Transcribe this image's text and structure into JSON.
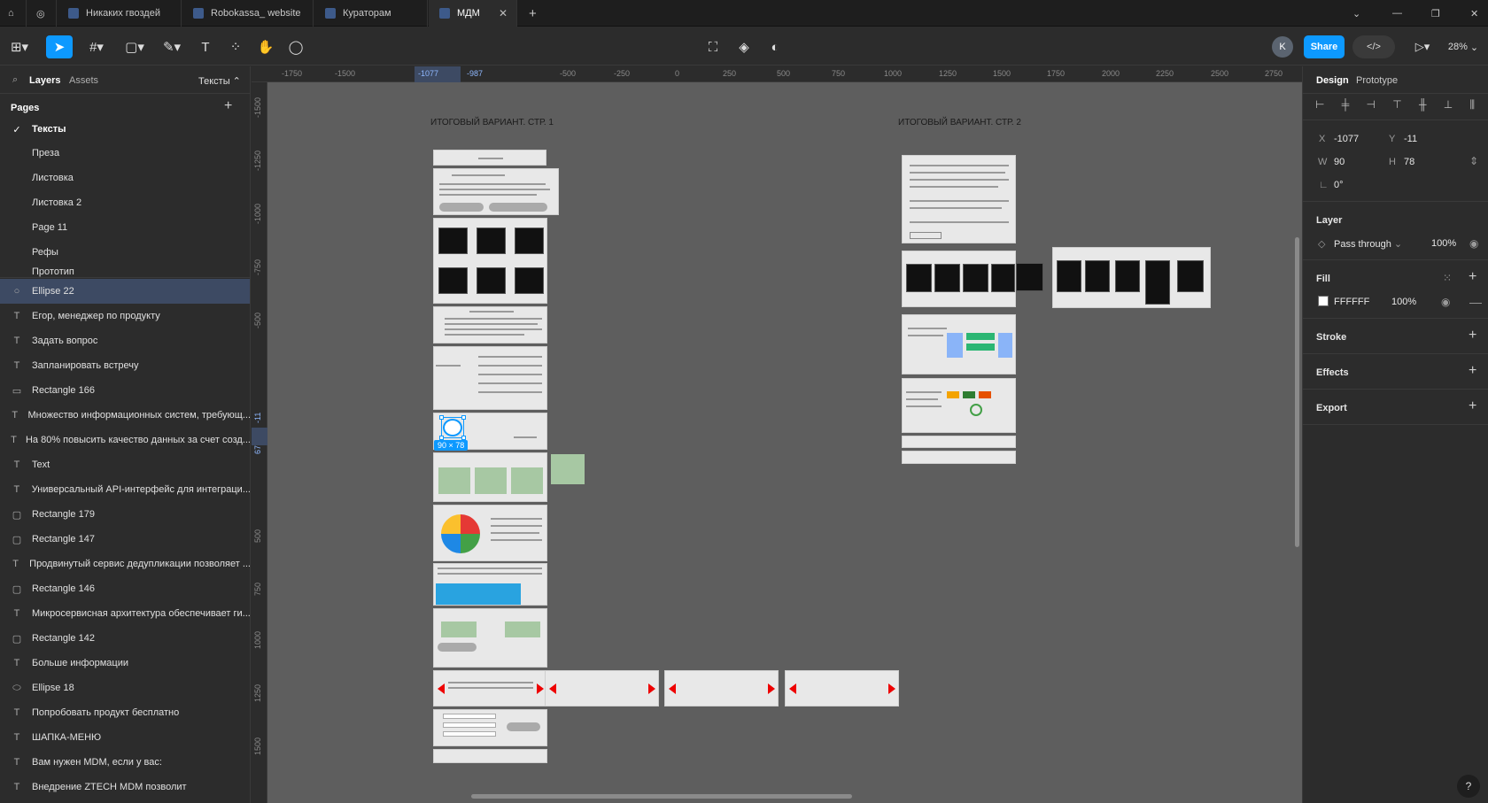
{
  "tabs": [
    {
      "label": "Никаких гвоздей"
    },
    {
      "label": "Robokassa_ website"
    },
    {
      "label": "Кураторам"
    },
    {
      "label": "МДМ"
    }
  ],
  "toolbar": {
    "share_label": "Share",
    "zoom": "28%",
    "avatar": "K"
  },
  "left": {
    "layers_tab": "Layers",
    "assets_tab": "Assets",
    "page_selector": "Тексты",
    "pages_title": "Pages",
    "pages": [
      "Тексты",
      "Преза",
      "Листовка",
      "Листовка 2",
      "Page 11",
      "Рефы",
      "Прототип"
    ],
    "layers": [
      {
        "icon": "ellipse-icon",
        "label": "Ellipse 22"
      },
      {
        "icon": "text-icon",
        "label": "Егор, менеджер по продукту"
      },
      {
        "icon": "text-icon",
        "label": "Задать вопрос"
      },
      {
        "icon": "text-icon",
        "label": "Запланировать встречу"
      },
      {
        "icon": "rectangle-icon",
        "label": "Rectangle 166"
      },
      {
        "icon": "text-icon",
        "label": "Множество информационных систем, требующ..."
      },
      {
        "icon": "text-icon",
        "label": "На 80% повысить качество данных за счет созд..."
      },
      {
        "icon": "text-icon",
        "label": "Text"
      },
      {
        "icon": "text-icon",
        "label": "Универсальный API-интерфейс для интеграци..."
      },
      {
        "icon": "rectangle-icon",
        "label": "Rectangle 179"
      },
      {
        "icon": "rectangle-icon",
        "label": "Rectangle 147"
      },
      {
        "icon": "text-icon",
        "label": "Продвинутый сервис дедупликации позволяет ..."
      },
      {
        "icon": "rectangle-icon",
        "label": "Rectangle 146"
      },
      {
        "icon": "text-icon",
        "label": "Микросервисная архитектура обеспечивает ги..."
      },
      {
        "icon": "rectangle-icon",
        "label": "Rectangle 142"
      },
      {
        "icon": "text-icon",
        "label": "Больше информации"
      },
      {
        "icon": "ellipse-icon",
        "label": "Ellipse 18"
      },
      {
        "icon": "text-icon",
        "label": "Попробовать продукт бесплатно"
      },
      {
        "icon": "text-icon",
        "label": "ШАПКА-МЕНЮ"
      },
      {
        "icon": "text-icon",
        "label": "Вам нужен MDM, если у вас:"
      },
      {
        "icon": "text-icon",
        "label": "Внедрение ZTECH MDM позволит"
      }
    ]
  },
  "ruler": {
    "top": [
      "-1750",
      "-1500",
      "-1077",
      "-987",
      "-500",
      "-250",
      "0",
      "250",
      "500",
      "750",
      "1000",
      "1250",
      "1500",
      "1750",
      "2000",
      "2250",
      "2500",
      "2750"
    ],
    "left": [
      "-1500",
      "-1250",
      "-1000",
      "-750",
      "-500",
      "-11",
      "67",
      "500",
      "750",
      "1000",
      "1250",
      "1500"
    ]
  },
  "canvas": {
    "frame1_title": "ИТОГОВЫЙ ВАРИАНТ. СТР. 1",
    "frame2_title": "ИТОГОВЫЙ ВАРИАНТ. СТР. 2",
    "selection_size": "90 × 78"
  },
  "right": {
    "design_tab": "Design",
    "prototype_tab": "Prototype",
    "x_label": "X",
    "x_value": "-1077",
    "y_label": "Y",
    "y_value": "-11",
    "w_label": "W",
    "w_value": "90",
    "h_label": "H",
    "h_value": "78",
    "rotation": "0°",
    "layer_title": "Layer",
    "blend": "Pass through",
    "opacity": "100%",
    "fill_title": "Fill",
    "fill_hex": "FFFFFF",
    "fill_opacity": "100%",
    "stroke_title": "Stroke",
    "effects_title": "Effects",
    "export_title": "Export"
  },
  "colors": {
    "accent": "#0d99ff",
    "selected_row": "#3d4a63",
    "canvas": "#5e5e5e"
  }
}
